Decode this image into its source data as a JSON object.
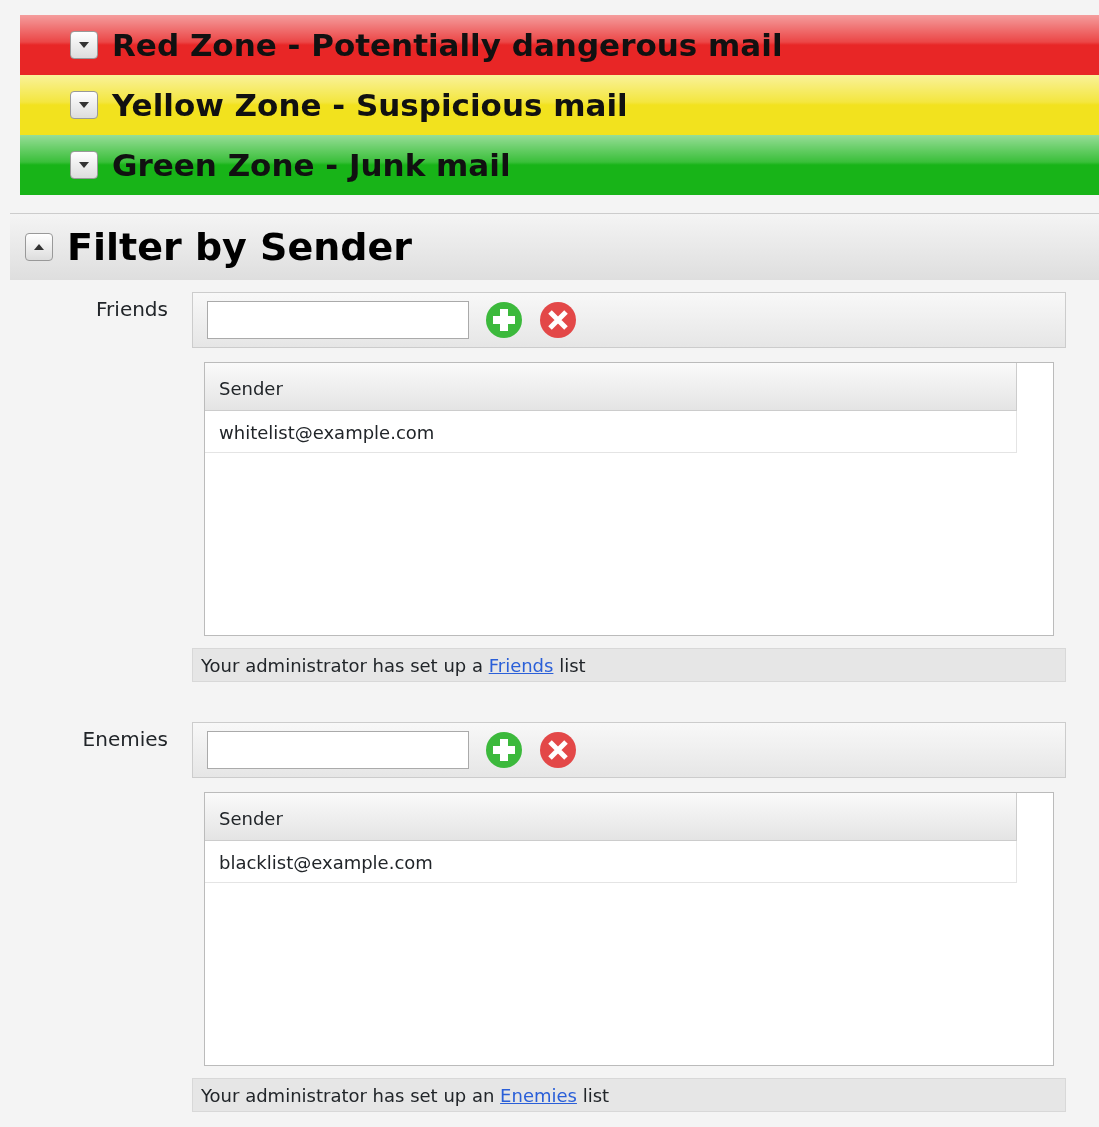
{
  "zones": [
    {
      "title": "Red Zone - Potentially dangerous mail",
      "color": "#e82626",
      "expanded": false
    },
    {
      "title": "Yellow Zone - Suspicious mail",
      "color": "#f2e21e",
      "expanded": false
    },
    {
      "title": "Green Zone - Junk mail",
      "color": "#18b418",
      "expanded": false
    }
  ],
  "filter": {
    "title": "Filter by Sender",
    "expanded": true,
    "lists": [
      {
        "label": "Friends",
        "column": "Sender",
        "rows": [
          "whitelist@example.com"
        ],
        "note_before": "Your administrator has set up a",
        "note_link": "Friends",
        "note_after": "list"
      },
      {
        "label": "Enemies",
        "column": "Sender",
        "rows": [
          "blacklist@example.com"
        ],
        "note_before": "Your administrator has set up an",
        "note_link": "Enemies",
        "note_after": "list"
      }
    ]
  }
}
